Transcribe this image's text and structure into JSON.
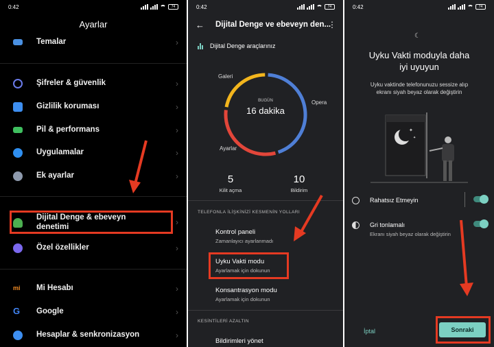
{
  "screen1": {
    "status": {
      "time": "0:42",
      "battery": "74"
    },
    "title": "Ayarlar",
    "items": [
      {
        "label": "Temalar",
        "icon": "themes-icon",
        "color": "#4a90e2"
      },
      {
        "label": "Şifreler & güvenlik",
        "icon": "fingerprint-icon",
        "color": "#6b7bea"
      },
      {
        "label": "Gizlilik koruması",
        "icon": "privacy-icon",
        "color": "#3d8ef0"
      },
      {
        "label": "Pil & performans",
        "icon": "battery-icon",
        "color": "#3fbf5f"
      },
      {
        "label": "Uygulamalar",
        "icon": "gear-icon",
        "color": "#2f8ff0"
      },
      {
        "label": "Ek ayarlar",
        "icon": "dots-icon",
        "color": "#8e9aad"
      },
      {
        "label_line1": "Dijital Denge & ebeveyn",
        "label_line2": "denetimi",
        "icon": "wellbeing-icon",
        "color": "#4caf50"
      },
      {
        "label": "Özel özellikler",
        "icon": "special-features-icon",
        "color": "#7b68ee"
      },
      {
        "label": "Mi Hesabı",
        "icon": "mi-icon",
        "color": "#f08a24"
      },
      {
        "label": "Google",
        "icon": "google-icon",
        "color": "#4285f4"
      },
      {
        "label": "Hesaplar & senkronizasyon",
        "icon": "account-icon",
        "color": "#3d8ef0"
      }
    ]
  },
  "screen2": {
    "status": {
      "time": "0:42",
      "battery": "74"
    },
    "title": "Dijital Denge ve ebeveyn den...",
    "tools_label": "Dijital Denge araçlarınız",
    "ring": {
      "today_label": "BUGÜN",
      "total": "16 dakika",
      "labels": {
        "galeri": "Galeri",
        "opera": "Opera",
        "ayarlar": "Ayarlar"
      },
      "segments": [
        {
          "name": "Opera",
          "fraction": 0.45,
          "color": "#4f7fd6"
        },
        {
          "name": "Ayarlar",
          "fraction": 0.32,
          "color": "#e2463a"
        },
        {
          "name": "Galeri",
          "fraction": 0.23,
          "color": "#f2b51d"
        }
      ]
    },
    "unlocks": {
      "value": "5",
      "label": "Kilit açma"
    },
    "notifications": {
      "value": "10",
      "label": "Bildirim"
    },
    "section1": "TELEFONLA İLİŞKİNİZİ KESMENİN YOLLARI",
    "items": [
      {
        "title": "Kontrol paneli",
        "subtitle": "Zamanlayıcı ayarlanmadı"
      },
      {
        "title": "Uyku Vakti modu",
        "subtitle": "Ayarlamak için dokunun"
      },
      {
        "title": "Konsantrasyon modu",
        "subtitle": "Ayarlamak için dokunun"
      }
    ],
    "section2": "KESİNTİLERİ AZALTIN",
    "item4": "Bildirimleri yönet"
  },
  "screen3": {
    "status": {
      "time": "0:42",
      "battery": "74"
    },
    "heading_line1": "Uyku Vakti moduyla daha",
    "heading_line2": "iyi uyuyun",
    "desc_line1": "Uyku vaktinde telefonunuzu sessize alıp",
    "desc_line2": "ekranı siyah beyaz olarak değiştirin",
    "toggle1": {
      "title": "Rahatsız Etmeyin",
      "on": true
    },
    "toggle2": {
      "title": "Gri tonlamalı",
      "subtitle": "Ekranı siyah beyaz olarak değiştirin",
      "on": true
    },
    "cancel": "İptal",
    "next": "Sonraki"
  }
}
